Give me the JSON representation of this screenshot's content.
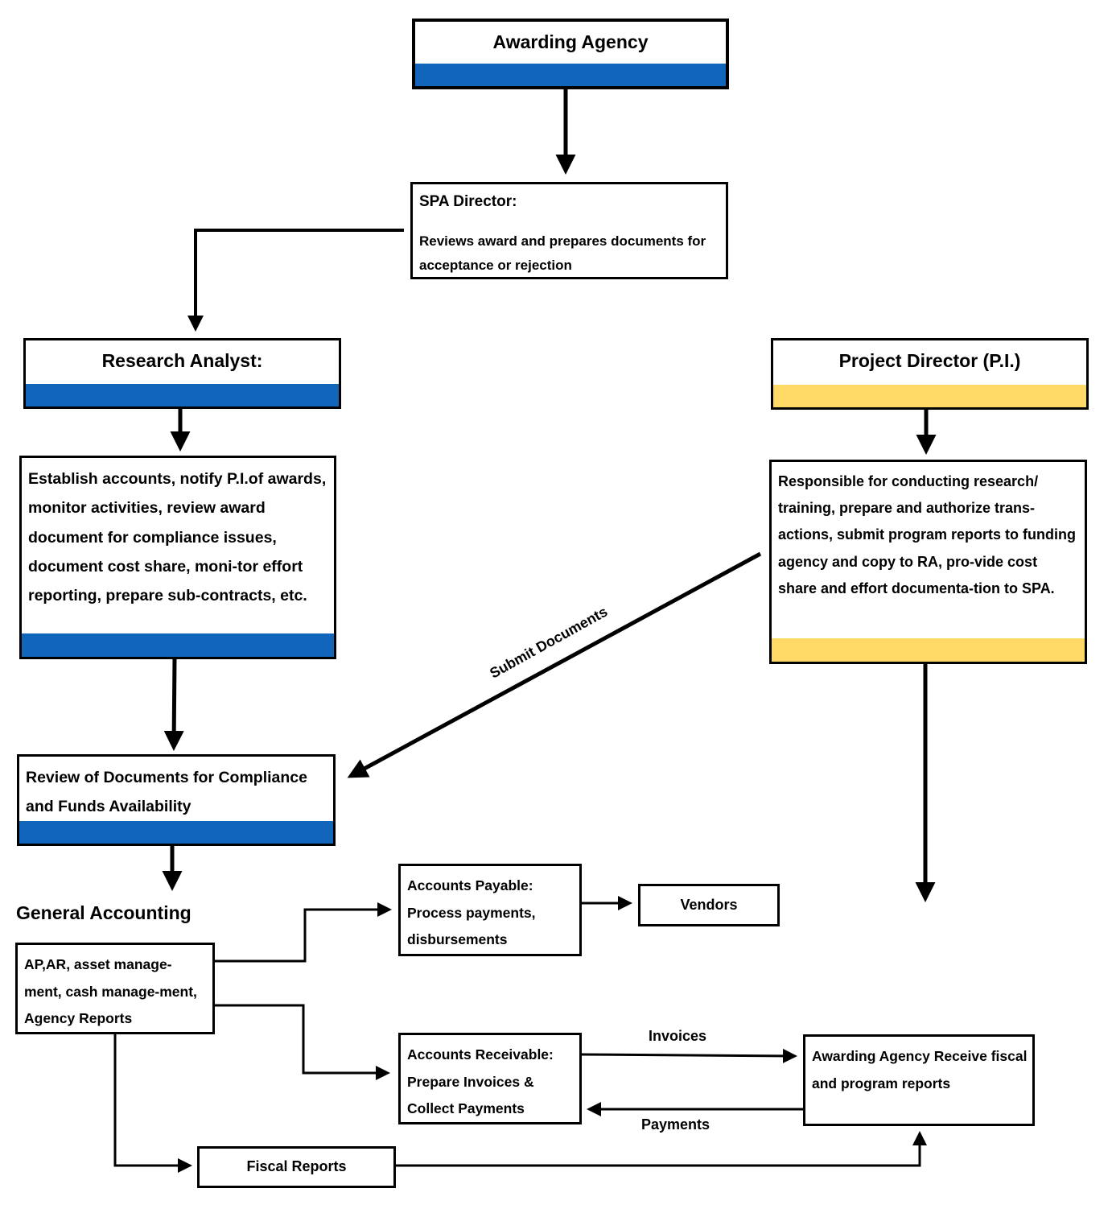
{
  "colors": {
    "blue": "#1166BB",
    "yellow": "#FFD966",
    "line": "#000000"
  },
  "awarding_agency_top": {
    "title": "Awarding Agency"
  },
  "spa_director": {
    "title": "SPA Director:",
    "text": "Reviews award and prepares documents for acceptance or rejection"
  },
  "research_analyst": {
    "title": "Research Analyst:"
  },
  "project_director": {
    "title": "Project Director (P.I.)"
  },
  "ra_duties": {
    "text": "Establish accounts, notify P.I.of awards, monitor activities, review award document for compliance issues, document cost share, moni-tor effort reporting, prepare sub-contracts, etc."
  },
  "pi_duties": {
    "text": "Responsible for conducting research/ training, prepare and authorize trans-actions, submit program reports to funding agency and copy to RA, pro-vide cost share and effort documenta-tion to SPA."
  },
  "review_docs": {
    "text": "Review of Documents for Compliance and Funds Availability"
  },
  "submit_documents_label": "Submit Documents",
  "general_accounting": {
    "heading": "General Accounting",
    "text": "AP,AR, asset manage-ment, cash manage-ment, Agency Reports"
  },
  "accounts_payable": {
    "text": "Accounts Payable: Process payments, disbursements"
  },
  "vendors": {
    "title": "Vendors"
  },
  "accounts_receivable": {
    "text": "Accounts Receivable: Prepare Invoices & Collect Payments"
  },
  "awarding_agency_bottom": {
    "text": "Awarding Agency Receive fiscal and program reports"
  },
  "invoices_label": "Invoices",
  "payments_label": "Payments",
  "fiscal_reports": {
    "title": "Fiscal Reports"
  }
}
